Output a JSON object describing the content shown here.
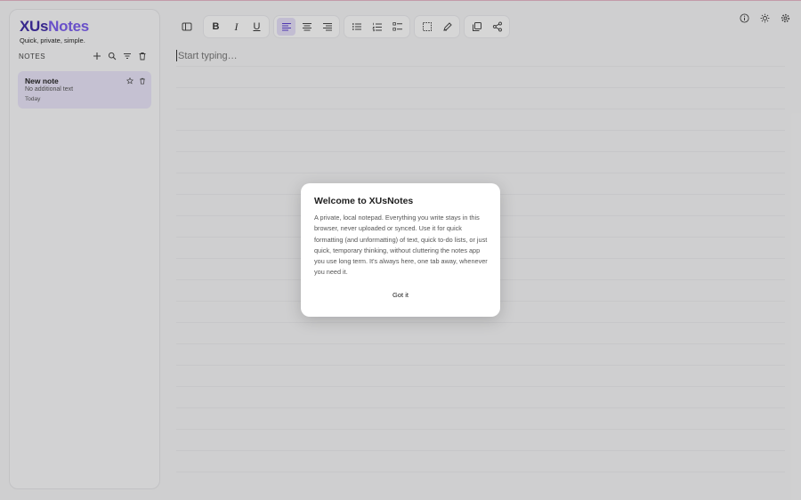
{
  "brand": {
    "name_x": "XUs",
    "name_rest": "Notes",
    "tagline": "Quick, private, simple."
  },
  "sidebar": {
    "notes_label": "NOTES",
    "icons": [
      "add-icon",
      "search-icon",
      "sort-icon",
      "trash-icon"
    ],
    "notes": [
      {
        "title": "New note",
        "preview": "No additional text",
        "date": "Today"
      }
    ]
  },
  "toolbar": {
    "groups": [
      [
        "sidebar-toggle-icon"
      ],
      [
        "bold",
        "italic",
        "underline"
      ],
      [
        "align-left",
        "align-center",
        "align-right"
      ],
      [
        "bullet-list",
        "numbered-list",
        "checklist"
      ],
      [
        "select",
        "highlight"
      ],
      [
        "copy",
        "share"
      ]
    ],
    "bold_label": "B",
    "italic_label": "I",
    "underline_label": "U",
    "active": "align-left"
  },
  "top_right": [
    "info-icon",
    "theme-icon",
    "settings-icon"
  ],
  "editor": {
    "placeholder": "Start typing…"
  },
  "modal": {
    "title": "Welcome to XUsNotes",
    "body": "A private, local notepad. Everything you write stays in this browser, never uploaded or synced. Use it for quick formatting (and unformatting) of text, quick to-do lists, or just quick, temporary thinking, without cluttering the notes app you use long term. It's always here, one tab away, whenever you need it.",
    "button": "Got it"
  },
  "colors": {
    "accent": "#7b5cf0",
    "accent_dark": "#3d2aa6",
    "selected_note": "#ebe6fb"
  }
}
